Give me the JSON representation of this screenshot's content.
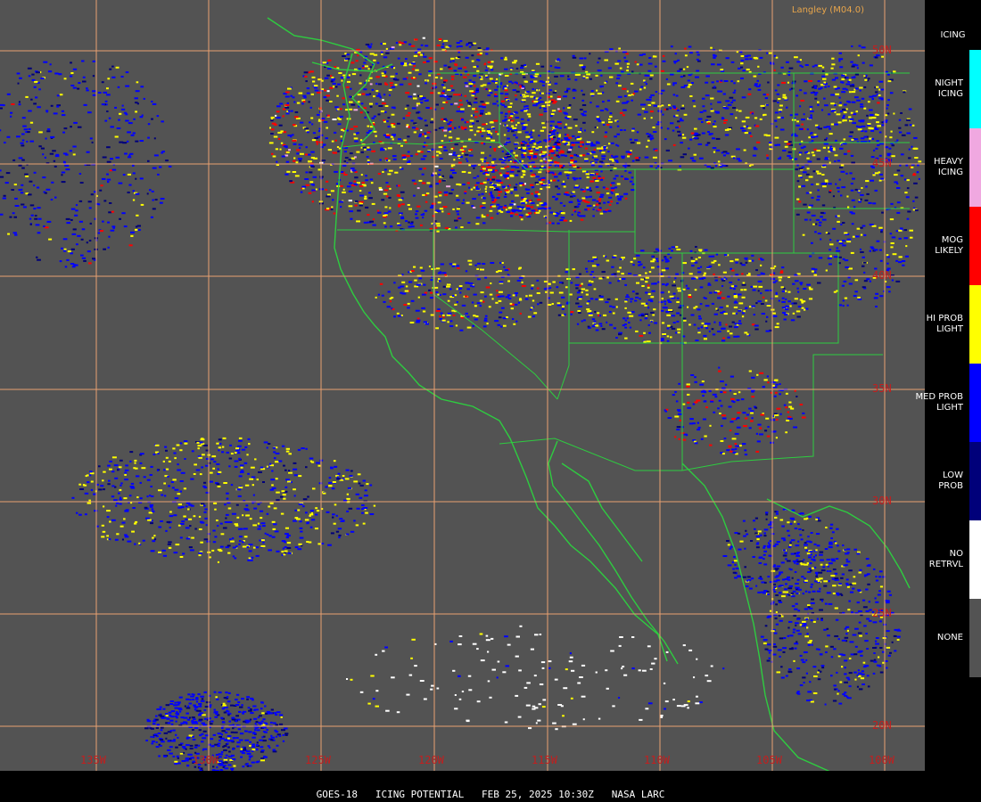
{
  "credit": "Langley (M04.0)",
  "footer": {
    "text": "GOES-18   ICING POTENTIAL   FEB 25, 2025 10:30Z   NASA LARC"
  },
  "legend": {
    "title": "ICING",
    "items": [
      {
        "label": "NIGHT\nICING",
        "color": "#00ffff"
      },
      {
        "label": "HEAVY\nICING",
        "color": "#f0a8e0"
      },
      {
        "label": "MOG\nLIKELY",
        "color": "#ff0000"
      },
      {
        "label": "HI PROB\nLIGHT",
        "color": "#ffff00"
      },
      {
        "label": "MED PROB\nLIGHT",
        "color": "#0000ff"
      },
      {
        "label": "LOW\nPROB",
        "color": "#00007a"
      },
      {
        "label": "NO\nRETRVL",
        "color": "#ffffff"
      },
      {
        "label": "NONE",
        "color": "#535353"
      }
    ]
  },
  "grid": {
    "lon_labels": [
      "135W",
      "130W",
      "125W",
      "120W",
      "115W",
      "110W",
      "105W",
      "100W"
    ],
    "lat_labels": [
      "50N",
      "45N",
      "40N",
      "35N",
      "30N",
      "25N",
      "20N"
    ],
    "line_color": "#e8a070"
  },
  "map": {
    "background_color": "#535353",
    "boundary_color": "#2ecc40",
    "precip_colors": [
      "#0000ff",
      "#ffff00",
      "#ff0000",
      "#00007a",
      "#ffffff",
      "#f0a8e0"
    ]
  }
}
